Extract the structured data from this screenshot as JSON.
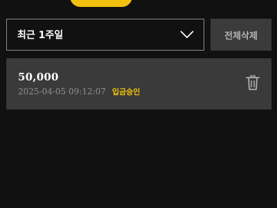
{
  "filter": {
    "period_label": "최근 1주일"
  },
  "toolbar": {
    "delete_all_label": "전체삭제"
  },
  "records": [
    {
      "amount": "50,000",
      "timestamp": "2025-04-05 09:12:07",
      "status": "입금승인"
    }
  ],
  "icons": {
    "dropdown": "chevron-down-icon",
    "delete": "trash-icon"
  },
  "colors": {
    "background": "#111111",
    "accent": "#f2c10f",
    "card": "#3a3a3a",
    "button": "#3b3b3b"
  }
}
